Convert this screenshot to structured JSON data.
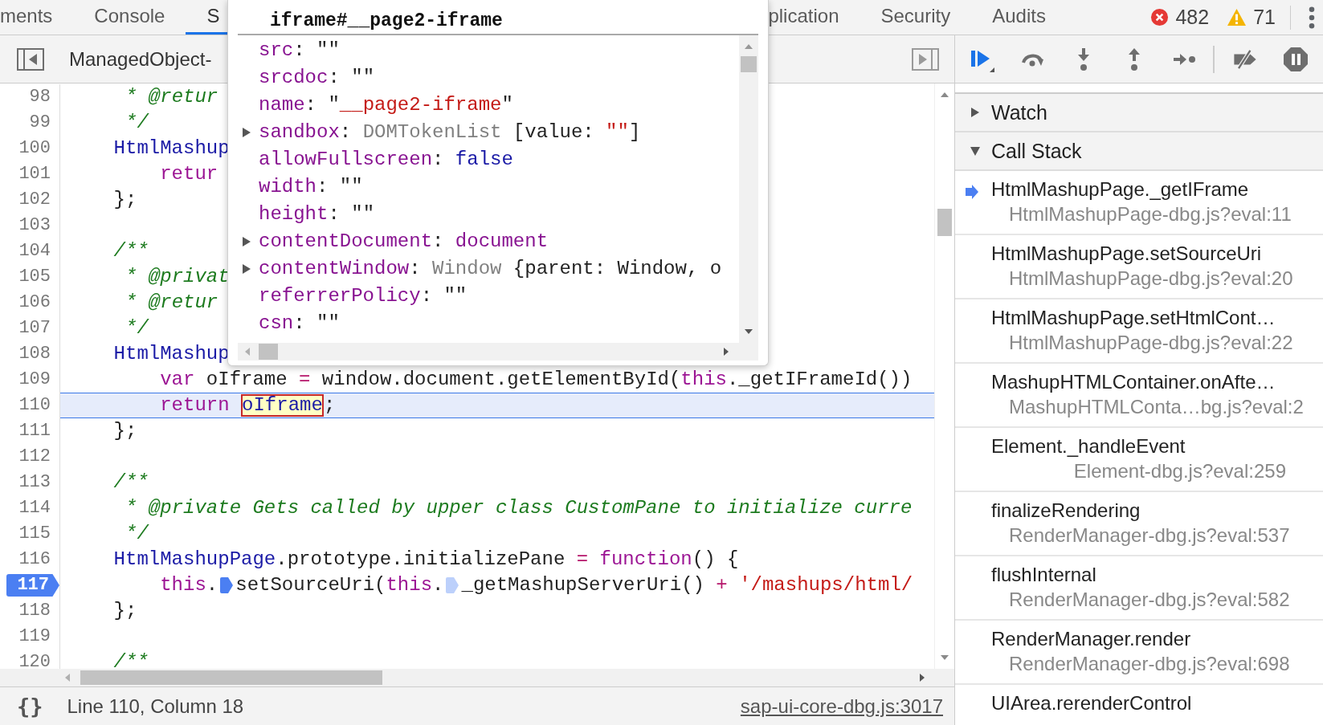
{
  "tabs": [
    {
      "label": "ments",
      "selected": false
    },
    {
      "label": "Console",
      "selected": false
    },
    {
      "label": "S",
      "selected": true
    },
    {
      "label": "plication",
      "selected": false
    },
    {
      "label": "Security",
      "selected": false
    },
    {
      "label": "Audits",
      "selected": false
    }
  ],
  "issues": {
    "errors": "482",
    "warnings": "71"
  },
  "editor": {
    "file_tab": "ManagedObject-",
    "lines": [
      {
        "number": "98",
        "current": false,
        "breakpoint": false,
        "tokens": [
          {
            "kind": "comment",
            "text": "     * @retur"
          }
        ]
      },
      {
        "number": "99",
        "current": false,
        "breakpoint": false,
        "tokens": [
          {
            "kind": "comment",
            "text": "     */"
          }
        ]
      },
      {
        "number": "100",
        "current": false,
        "breakpoint": false,
        "tokens": [
          {
            "kind": "def",
            "text": "    HtmlMashup"
          }
        ]
      },
      {
        "number": "101",
        "current": false,
        "breakpoint": false,
        "tokens": [
          {
            "kind": "keyword",
            "text": "        retur"
          }
        ]
      },
      {
        "number": "102",
        "current": false,
        "breakpoint": false,
        "tokens": [
          {
            "kind": "plain",
            "text": "    };"
          }
        ]
      },
      {
        "number": "103",
        "current": false,
        "breakpoint": false
      },
      {
        "number": "104",
        "current": false,
        "breakpoint": false,
        "tokens": [
          {
            "kind": "comment",
            "text": "    /**"
          }
        ]
      },
      {
        "number": "105",
        "current": false,
        "breakpoint": false,
        "tokens": [
          {
            "kind": "comment",
            "text": "     * @privat"
          }
        ]
      },
      {
        "number": "106",
        "current": false,
        "breakpoint": false,
        "tokens": [
          {
            "kind": "comment",
            "text": "     * @retur"
          }
        ]
      },
      {
        "number": "107",
        "current": false,
        "breakpoint": false,
        "tokens": [
          {
            "kind": "comment",
            "text": "     */"
          }
        ]
      },
      {
        "number": "108",
        "current": false,
        "breakpoint": false,
        "tokens": [
          {
            "kind": "def",
            "text": "    HtmlMashup"
          }
        ]
      },
      {
        "number": "109",
        "current": false,
        "breakpoint": false,
        "tokens": [
          {
            "kind": "keyword",
            "text": "        var"
          },
          {
            "kind": "plain",
            "text": " oIframe "
          },
          {
            "kind": "op",
            "text": "="
          },
          {
            "kind": "plain",
            "text": " window.document.getElementById("
          },
          {
            "kind": "keyword",
            "text": "this"
          },
          {
            "kind": "plain",
            "text": "._getIFrameId())"
          }
        ]
      },
      {
        "number": "110",
        "current": true,
        "breakpoint": false,
        "tokens": [
          {
            "kind": "keyword",
            "text": "        return "
          },
          {
            "kind": "highlight",
            "text": "oIframe"
          },
          {
            "kind": "plain",
            "text": ";"
          }
        ]
      },
      {
        "number": "111",
        "current": false,
        "breakpoint": false,
        "tokens": [
          {
            "kind": "plain",
            "text": "    };"
          }
        ]
      },
      {
        "number": "112",
        "current": false,
        "breakpoint": false
      },
      {
        "number": "113",
        "current": false,
        "breakpoint": false,
        "tokens": [
          {
            "kind": "comment",
            "text": "    /**"
          }
        ]
      },
      {
        "number": "114",
        "current": false,
        "breakpoint": false,
        "tokens": [
          {
            "kind": "comment",
            "text": "     * @private Gets called by upper class CustomPane to initialize curre"
          }
        ]
      },
      {
        "number": "115",
        "current": false,
        "breakpoint": false,
        "tokens": [
          {
            "kind": "comment",
            "text": "     */"
          }
        ]
      },
      {
        "number": "116",
        "current": false,
        "breakpoint": false,
        "tokens": [
          {
            "kind": "def",
            "text": "    HtmlMashupPage"
          },
          {
            "kind": "plain",
            "text": ".prototype.initializePane "
          },
          {
            "kind": "op",
            "text": "="
          },
          {
            "kind": "keyword",
            "text": " function"
          },
          {
            "kind": "plain",
            "text": "() {"
          }
        ]
      },
      {
        "number": "117",
        "current": false,
        "breakpoint": true,
        "tokens": [
          {
            "kind": "keyword",
            "text": "        this"
          },
          {
            "kind": "plain",
            "text": "."
          },
          {
            "kind": "inline-breakpoint",
            "enabled": true
          },
          {
            "kind": "plain",
            "text": "setSourceUri("
          },
          {
            "kind": "keyword",
            "text": "this"
          },
          {
            "kind": "plain",
            "text": "."
          },
          {
            "kind": "inline-breakpoint",
            "enabled": false
          },
          {
            "kind": "plain",
            "text": "_getMashupServerUri() "
          },
          {
            "kind": "op",
            "text": "+"
          },
          {
            "kind": "string",
            "text": " '/mashups/html/"
          }
        ]
      },
      {
        "number": "118",
        "current": false,
        "breakpoint": false,
        "tokens": [
          {
            "kind": "plain",
            "text": "    };"
          }
        ]
      },
      {
        "number": "119",
        "current": false,
        "breakpoint": false
      },
      {
        "number": "120",
        "current": false,
        "breakpoint": false,
        "tokens": [
          {
            "kind": "comment",
            "text": "    /**"
          }
        ]
      }
    ],
    "status": {
      "pretty_print": "{}",
      "position": "Line 110, Column 18",
      "source_link": "sap-ui-core-dbg.js:3017"
    }
  },
  "popover": {
    "title": "iframe#__page2-iframe",
    "properties": [
      {
        "expandable": false,
        "name": "src",
        "value": [
          {
            "kind": "punct",
            "text": ": \"\""
          }
        ]
      },
      {
        "expandable": false,
        "name": "srcdoc",
        "value": [
          {
            "kind": "punct",
            "text": ": \"\""
          }
        ]
      },
      {
        "expandable": false,
        "name": "name",
        "value": [
          {
            "kind": "punct",
            "text": ": \""
          },
          {
            "kind": "string",
            "text": "__page2-iframe"
          },
          {
            "kind": "punct",
            "text": "\""
          }
        ]
      },
      {
        "expandable": true,
        "name": "sandbox",
        "value": [
          {
            "kind": "punct",
            "text": ": "
          },
          {
            "kind": "type",
            "text": "DOMTokenList"
          },
          {
            "kind": "punct",
            "text": " [value: "
          },
          {
            "kind": "string",
            "text": "\"\""
          },
          {
            "kind": "punct",
            "text": "]"
          }
        ]
      },
      {
        "expandable": false,
        "name": "allowFullscreen",
        "value": [
          {
            "kind": "punct",
            "text": ": "
          },
          {
            "kind": "literal",
            "text": "false"
          }
        ]
      },
      {
        "expandable": false,
        "name": "width",
        "value": [
          {
            "kind": "punct",
            "text": ": \"\""
          }
        ]
      },
      {
        "expandable": false,
        "name": "height",
        "value": [
          {
            "kind": "punct",
            "text": ": \"\""
          }
        ]
      },
      {
        "expandable": true,
        "name": "contentDocument",
        "value": [
          {
            "kind": "punct",
            "text": ": "
          },
          {
            "kind": "object",
            "text": "document"
          }
        ]
      },
      {
        "expandable": true,
        "name": "contentWindow",
        "value": [
          {
            "kind": "punct",
            "text": ": "
          },
          {
            "kind": "type",
            "text": "Window"
          },
          {
            "kind": "punct",
            "text": " {parent: Window, o"
          }
        ]
      },
      {
        "expandable": false,
        "name": "referrerPolicy",
        "value": [
          {
            "kind": "punct",
            "text": ": \"\""
          }
        ]
      },
      {
        "expandable": false,
        "name": "csn",
        "value": [
          {
            "kind": "punct",
            "text": ": \"\""
          }
        ]
      }
    ]
  },
  "debugger": {
    "sections": [
      {
        "label": "Watch",
        "expanded": false
      },
      {
        "label": "Call Stack",
        "expanded": true
      }
    ],
    "call_stack": [
      {
        "name": "HtmlMashupPage._getIFrame",
        "location": "HtmlMashupPage-dbg.js?eval:11",
        "current": true
      },
      {
        "name": "HtmlMashupPage.setSourceUri",
        "location": "HtmlMashupPage-dbg.js?eval:20",
        "current": false
      },
      {
        "name": "HtmlMashupPage.setHtmlCont…",
        "location": "HtmlMashupPage-dbg.js?eval:22",
        "current": false
      },
      {
        "name": "MashupHTMLContainer.onAfte…",
        "location": "MashupHTMLConta…bg.js?eval:2",
        "current": false
      },
      {
        "name": "Element._handleEvent",
        "location": "Element-dbg.js?eval:259",
        "current": false
      },
      {
        "name": "finalizeRendering",
        "location": "RenderManager-dbg.js?eval:537",
        "current": false
      },
      {
        "name": "flushInternal",
        "location": "RenderManager-dbg.js?eval:582",
        "current": false
      },
      {
        "name": "RenderManager.render",
        "location": "RenderManager-dbg.js?eval:698",
        "current": false
      },
      {
        "name": "UIArea.rerenderControl",
        "current": false
      }
    ]
  }
}
